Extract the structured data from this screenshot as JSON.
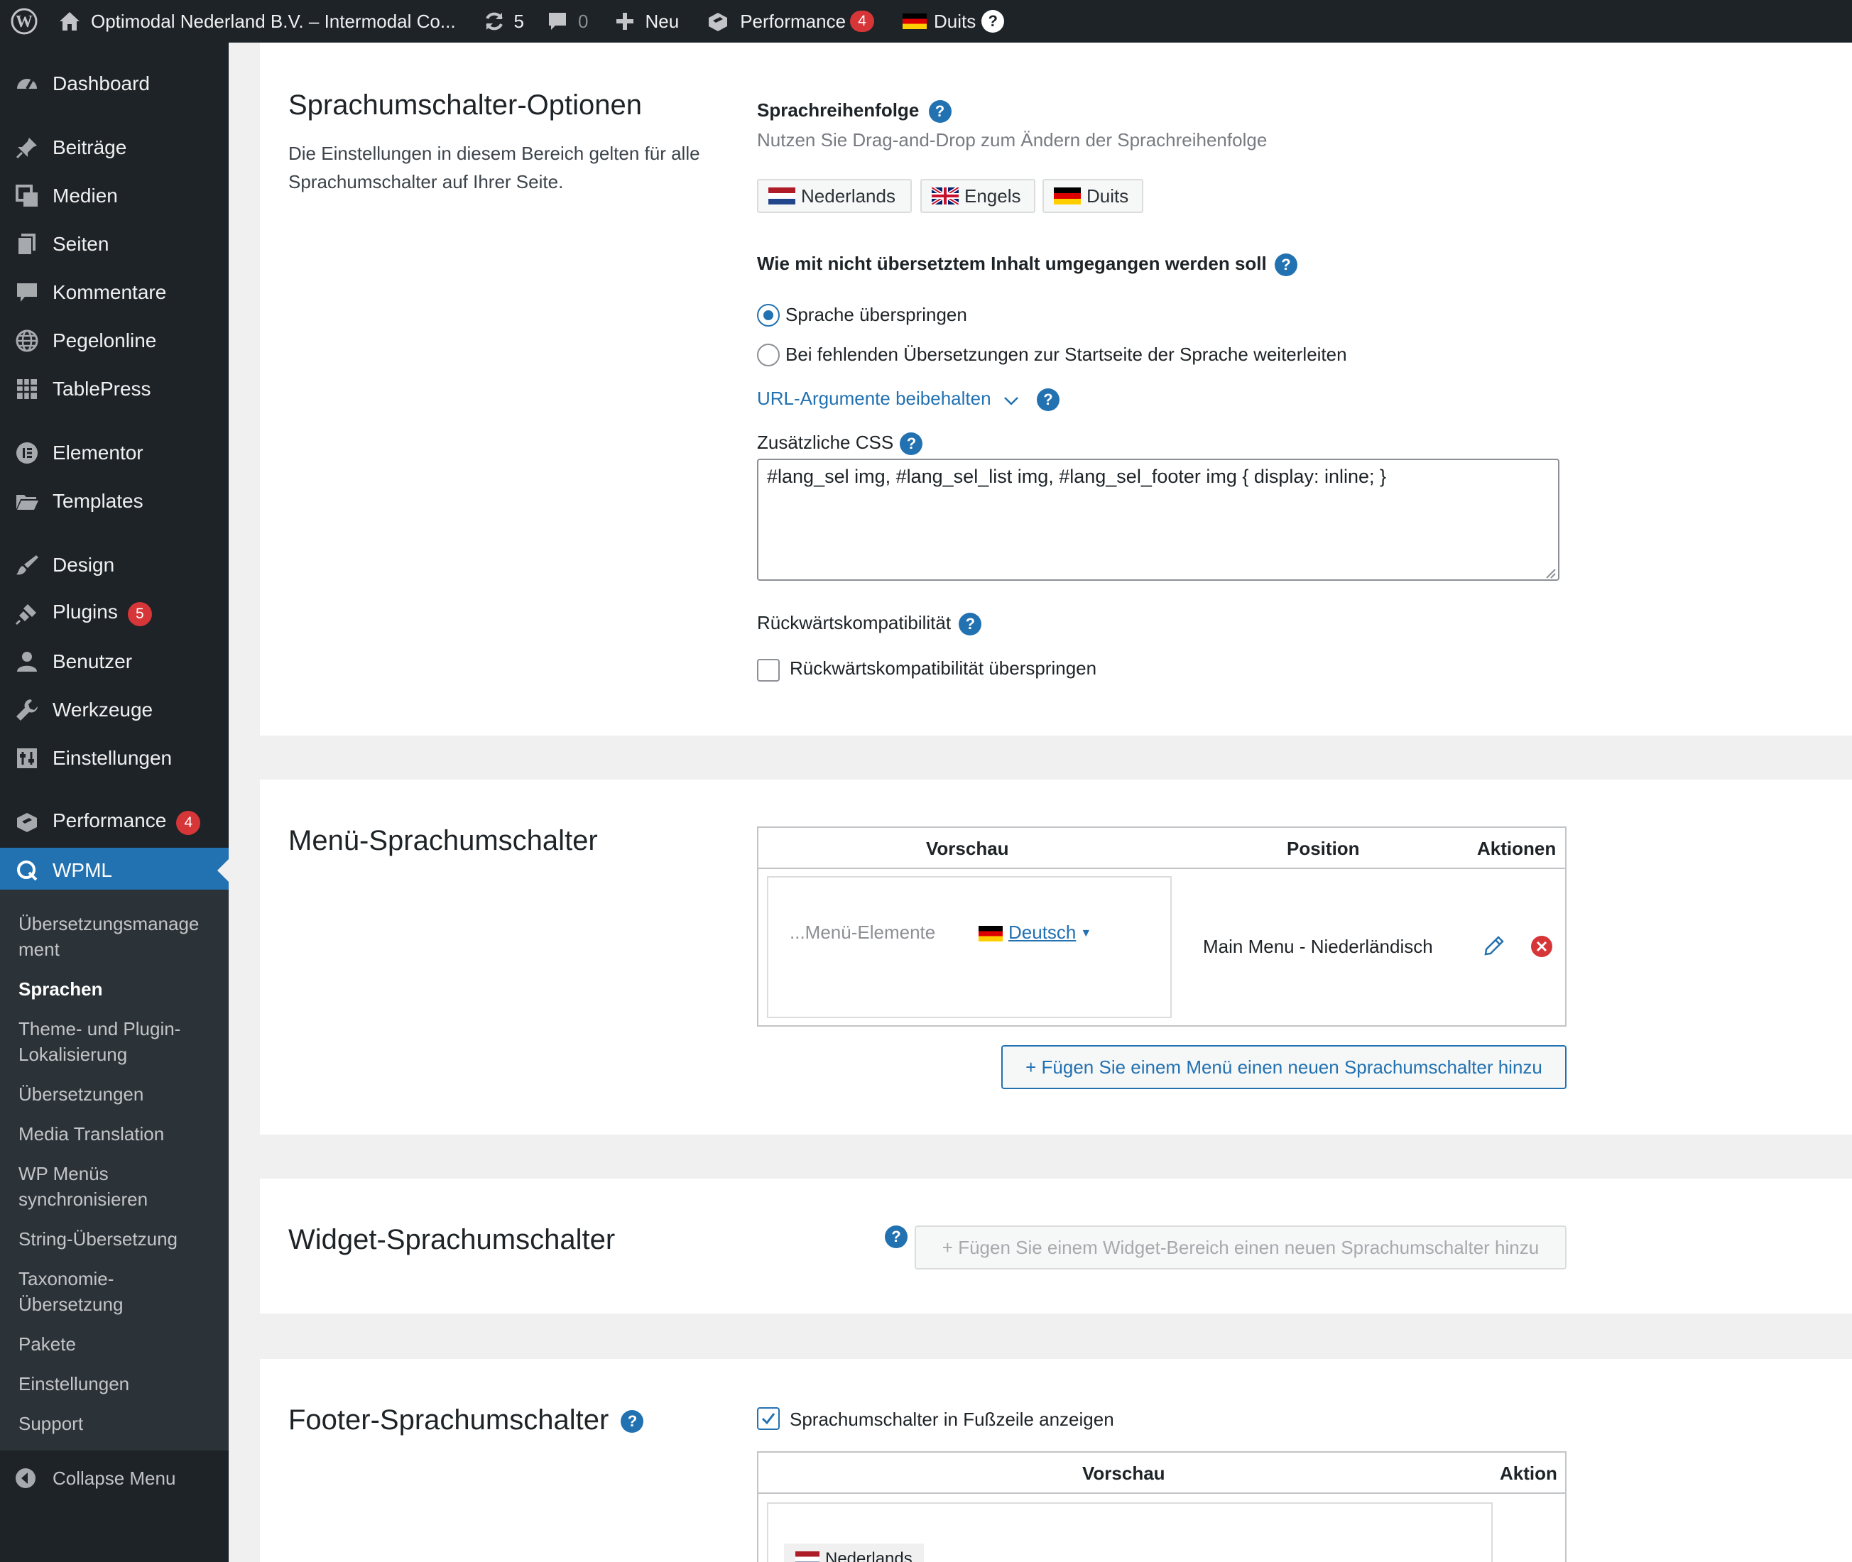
{
  "admin_bar": {
    "site_title": "Optimodal Nederland B.V. – Intermodal Co...",
    "updates_count": "5",
    "comments_count": "0",
    "new_label": "Neu",
    "performance_label": "Performance",
    "performance_badge": "4",
    "language_label": "Duits",
    "help_label": "?"
  },
  "sidebar": {
    "items": [
      {
        "label": "Dashboard",
        "icon": "dashboard-icon"
      },
      {
        "label": "Beiträge",
        "icon": "pin-icon"
      },
      {
        "label": "Medien",
        "icon": "media-icon"
      },
      {
        "label": "Seiten",
        "icon": "pages-icon"
      },
      {
        "label": "Kommentare",
        "icon": "comments-icon"
      },
      {
        "label": "Pegelonline",
        "icon": "globe-icon"
      },
      {
        "label": "TablePress",
        "icon": "table-icon"
      },
      {
        "label": "Elementor",
        "icon": "elementor-icon"
      },
      {
        "label": "Templates",
        "icon": "folder-icon"
      },
      {
        "label": "Design",
        "icon": "brush-icon"
      },
      {
        "label": "Plugins",
        "icon": "plugin-icon",
        "badge": "5"
      },
      {
        "label": "Benutzer",
        "icon": "user-icon"
      },
      {
        "label": "Werkzeuge",
        "icon": "wrench-icon"
      },
      {
        "label": "Einstellungen",
        "icon": "settings-icon"
      },
      {
        "label": "Performance",
        "icon": "performance-icon",
        "badge": "4"
      },
      {
        "label": "WPML",
        "icon": "wpml-icon"
      }
    ],
    "submenu": [
      "Übersetzungsmanage\nment",
      "Sprachen",
      "Theme- und Plugin-\nLokalisierung",
      "Übersetzungen",
      "Media Translation",
      "WP Menüs\nsynchronisieren",
      "String-Übersetzung",
      "Taxonomie-\nÜbersetzung",
      "Pakete",
      "Einstellungen",
      "Support"
    ],
    "collapse_label": "Collapse Menu"
  },
  "options": {
    "title": "Sprachumschalter-Optionen",
    "description": "Die Einstellungen in diesem Bereich gelten für alle Sprachumschalter auf Ihrer Seite.",
    "order_label": "Sprachreihenfolge",
    "order_hint": "Nutzen Sie Drag-and-Drop zum Ändern der Sprachreihenfolge",
    "languages": [
      "Nederlands",
      "Engels",
      "Duits"
    ],
    "untranslated_label": "Wie mit nicht übersetztem Inhalt umgegangen werden soll",
    "radio_skip": "Sprache überspringen",
    "radio_redirect": "Bei fehlenden Übersetzungen zur Startseite der Sprache weiterleiten",
    "url_args_label": "URL-Argumente beibehalten",
    "css_label": "Zusätzliche CSS",
    "css_value": "#lang_sel img, #lang_sel_list img, #lang_sel_footer img { display: inline; }",
    "compat_label": "Rückwärtskompatibilität",
    "compat_checkbox": "Rückwärtskompatibilität überspringen"
  },
  "menu_switcher": {
    "title": "Menü-Sprachumschalter",
    "col_preview": "Vorschau",
    "col_position": "Position",
    "col_actions": "Aktionen",
    "preview_items": "...Menü-Elemente",
    "preview_language": "Deutsch",
    "position_value": "Main Menu - Niederländisch",
    "add_button": "+ Fügen Sie einem Menü einen neuen Sprachumschalter hinzu"
  },
  "widget_switcher": {
    "title": "Widget-Sprachumschalter",
    "add_button": "+ Fügen Sie einem Widget-Bereich einen neuen Sprachumschalter hinzu"
  },
  "footer_switcher": {
    "title": "Footer-Sprachumschalter",
    "show_checkbox": "Sprachumschalter in Fußzeile anzeigen",
    "col_preview": "Vorschau",
    "col_action": "Aktion",
    "preview_language": "Nederlands"
  },
  "colors": {
    "accent": "#2271b1",
    "sidebar_bg": "#1d2327",
    "badge": "#d63638",
    "delete": "#d63638"
  }
}
